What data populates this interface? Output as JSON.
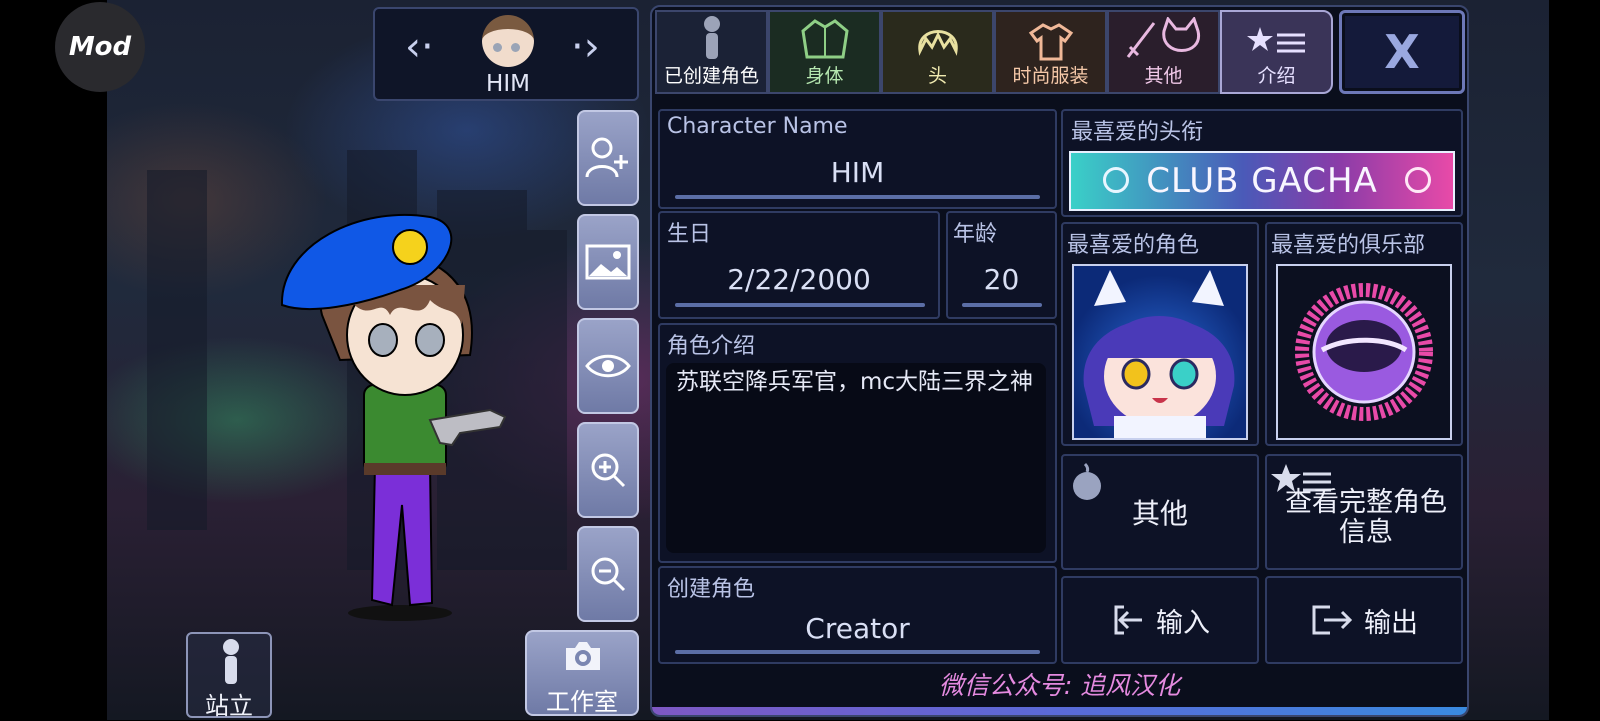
{
  "app": {
    "mod_badge": "Mod"
  },
  "character_selector": {
    "name": "HIM"
  },
  "bottom_left": {
    "stand_label": "站立",
    "studio_label": "工作室"
  },
  "tabs": [
    {
      "label": "已创建角色",
      "icon": "figure-icon",
      "color": "#ffffff"
    },
    {
      "label": "身体",
      "icon": "jacket-icon",
      "color": "#b6e8b0"
    },
    {
      "label": "头",
      "icon": "hair-icon",
      "color": "#f0eab0"
    },
    {
      "label": "时尚服装",
      "icon": "shirt-icon",
      "color": "#f5c8a8"
    },
    {
      "label": "其他",
      "icon": "sword-cat-icon",
      "color": "#f0c8e8"
    },
    {
      "label": "介绍",
      "icon": "star-list-icon",
      "color": "#e6e0ff"
    }
  ],
  "close_label": "X",
  "form": {
    "name_label": "Character Name",
    "name_value": "HIM",
    "birthday_label": "生日",
    "birthday_value": "2/22/2000",
    "age_label": "年龄",
    "age_value": "20",
    "intro_label": "角色介绍",
    "intro_value": "苏联空降兵军官，mc大陆三界之神",
    "creator_label": "创建角色",
    "creator_value": "Creator"
  },
  "right": {
    "fav_title_label": "最喜爱的头衔",
    "fav_title_value": "CLUB GACHA",
    "fav_char_label": "最喜爱的角色",
    "fav_club_label": "最喜爱的俱乐部",
    "other_label": "其他",
    "full_info_label": "查看完整角色信息",
    "import_label": "输入",
    "export_label": "输出"
  },
  "watermark": "微信公众号: 追风汉化",
  "colors": {
    "accent": "#5b6ea6",
    "panel": "#141a2e",
    "watermark": "#e58ae0"
  }
}
